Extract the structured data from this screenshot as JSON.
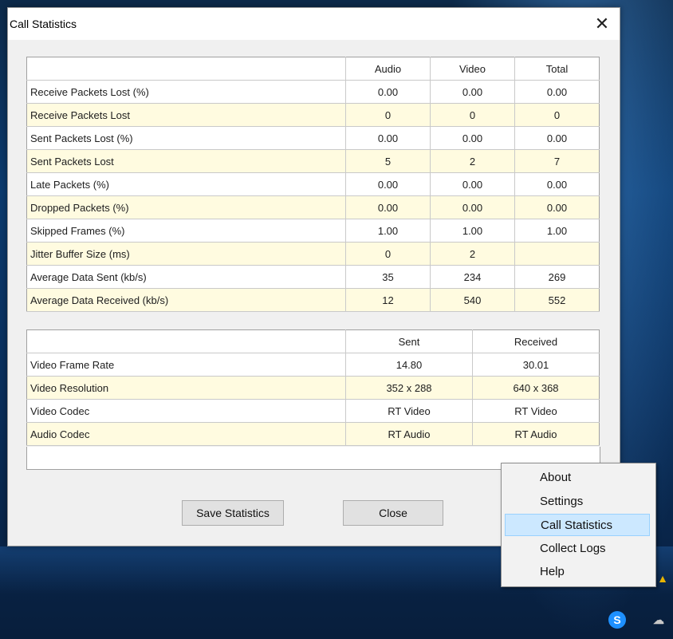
{
  "window": {
    "title": "Call Statistics",
    "close_glyph": "✕"
  },
  "media_table": {
    "columns": [
      "",
      "Audio",
      "Video",
      "Total"
    ],
    "rows": [
      {
        "label": "Receive Packets Lost (%)",
        "audio": "0.00",
        "video": "0.00",
        "total": "0.00"
      },
      {
        "label": "Receive Packets Lost",
        "audio": "0",
        "video": "0",
        "total": "0"
      },
      {
        "label": "Sent Packets Lost (%)",
        "audio": "0.00",
        "video": "0.00",
        "total": "0.00"
      },
      {
        "label": "Sent Packets Lost",
        "audio": "5",
        "video": "2",
        "total": "7"
      },
      {
        "label": "Late Packets (%)",
        "audio": "0.00",
        "video": "0.00",
        "total": "0.00"
      },
      {
        "label": "Dropped Packets (%)",
        "audio": "0.00",
        "video": "0.00",
        "total": "0.00"
      },
      {
        "label": "Skipped Frames (%)",
        "audio": "1.00",
        "video": "1.00",
        "total": "1.00"
      },
      {
        "label": "Jitter Buffer Size (ms)",
        "audio": "0",
        "video": "2",
        "total": ""
      },
      {
        "label": "Average Data Sent (kb/s)",
        "audio": "35",
        "video": "234",
        "total": "269"
      },
      {
        "label": "Average Data Received (kb/s)",
        "audio": "12",
        "video": "540",
        "total": "552"
      }
    ]
  },
  "video_table": {
    "columns": [
      "",
      "Sent",
      "Received"
    ],
    "rows": [
      {
        "label": "Video Frame Rate",
        "sent": "14.80",
        "received": "30.01"
      },
      {
        "label": "Video Resolution",
        "sent": "352 x 288",
        "received": "640 x 368"
      },
      {
        "label": "Video Codec",
        "sent": "RT Video",
        "received": "RT Video"
      },
      {
        "label": "Audio Codec",
        "sent": "RT Audio",
        "received": "RT Audio"
      }
    ]
  },
  "buttons": {
    "save": "Save Statistics",
    "close": "Close"
  },
  "context_menu": {
    "items": [
      "About",
      "Settings",
      "Call Statistics",
      "Collect Logs",
      "Help"
    ],
    "highlighted": "Call Statistics"
  },
  "tray": {
    "icons": [
      "skype-icon",
      "cloud-icon",
      "warning-icon"
    ]
  },
  "colors": {
    "row_alt": "#fffbe0",
    "menu_highlight": "#cce8ff"
  }
}
